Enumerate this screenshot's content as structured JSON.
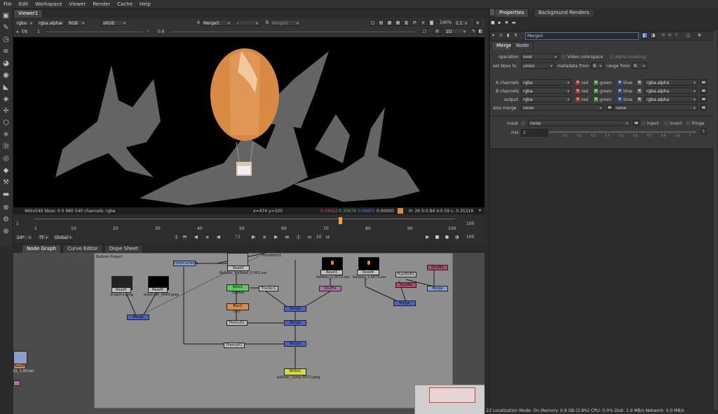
{
  "menubar": [
    "File",
    "Edit",
    "Workspace",
    "Viewer",
    "Render",
    "Cache",
    "Help"
  ],
  "viewer": {
    "tab": "Viewer1",
    "channels": "rgba",
    "alpha": "rgba.alpha",
    "colorspace": "RGB",
    "lut": "sRGB",
    "a_input": "Merge5",
    "a_label": "A",
    "b_label": "B",
    "b_input": "Merge5",
    "dash": "-",
    "gain_label": "f/8",
    "gain_value": "1",
    "gamma_label": "Y",
    "gamma_value": "0.6",
    "zoom": "140%",
    "ratio": "1:1",
    "mode": "2D"
  },
  "infobar": {
    "format": "960x540  bbox: 0 0 960 540  channels: rgba",
    "coords": "x=474 y=320",
    "r": "0.59022",
    "g": "0.30878",
    "b": "0.09601",
    "a": "0.00000",
    "hsv": "H: 26 S:0.84 V:0.59  L: 0.35319"
  },
  "timeline": {
    "start": "1",
    "end": "100",
    "end_right": "100",
    "ticks": [
      "1",
      "10",
      "20",
      "30",
      "40",
      "50",
      "60",
      "70",
      "80",
      "90",
      "100"
    ],
    "current_frame": "73",
    "fps": "24*",
    "tf": "TF",
    "scope": "Global",
    "step": "10",
    "end_field": "100"
  },
  "nodegraph": {
    "tabs": [
      "Node Graph",
      "Curve Editor",
      "Dope Sheet"
    ],
    "backdrop_label": "Balloon Project",
    "nodes": {
      "read2": "Read2",
      "read2_file": "Balloon_Sailboat_0.001.exr",
      "colorcorrect": "ColorCorrect1",
      "transform": "Transform1",
      "roto": "Roto1",
      "roto_sub": "(alpha)",
      "blur": "Blur1",
      "blur_sub": "(all)",
      "tracker": "Tracker1",
      "premult1": "Premult1",
      "premult2": "Premult2",
      "read3": "Read3",
      "read3_file": "balloon_1.0073.exr",
      "read4": "Read4",
      "read4_file": "balloon_1.0073.exr",
      "read5": "Read5",
      "read5_file": "dragons.jpeg",
      "read6": "Read6",
      "read6_file": "prelim06_0000.jpeg",
      "hueshift": "HueShift1",
      "shuffle": "Shuffle",
      "write": "Write1",
      "write_file": "balloon_comp.0073.jpeg",
      "merge_label": "Merge",
      "side_read": "Read5",
      "side_file": "01_1.00.exr"
    }
  },
  "properties": {
    "tabs": [
      "Properties",
      "Background Renders"
    ],
    "node_name": "Merge5",
    "subtabs": [
      "Merge",
      "Node"
    ],
    "operation_label": "operation",
    "operation": "over",
    "video_colorspace": "Video colorspace",
    "alpha_masking": "alpha masking",
    "setbbox_label": "set bbox to",
    "setbbox": "union",
    "metadata_label": "metadata from",
    "metadata": "B",
    "range_label": "range from",
    "range": "B",
    "a_channels_label": "A channels",
    "b_channels_label": "B channels",
    "output_label": "output",
    "also_merge_label": "also merge",
    "channels_value": "rgba",
    "alpha_value": "rgba.alpha",
    "none": "none",
    "red": "red",
    "green": "green",
    "blue": "blue",
    "mask_label": "mask",
    "mask_value": "none",
    "inject": "inject",
    "invert": "invert",
    "fringe": "fringe",
    "mix_label": "mix",
    "mix_value": "1",
    "mix_ticks": [
      "0",
      "0.1",
      "0.2",
      "0.3",
      "0.4",
      "0.5",
      "0.6",
      "0.7",
      "0.8",
      "0.9",
      "1"
    ]
  },
  "status": "Channel Count: 22  Localization Mode: On  Memory: 0.9 GB (2.8%)  CPU: 0.0%  Disk: 1.9 MB/s  Network: 0.0 MB/s",
  "colors": {
    "accent_orange": "#e8a23a",
    "red_value": "#e05050",
    "green_value": "#50c050",
    "blue_value": "#6080e0",
    "balloon": "#d88a45"
  }
}
